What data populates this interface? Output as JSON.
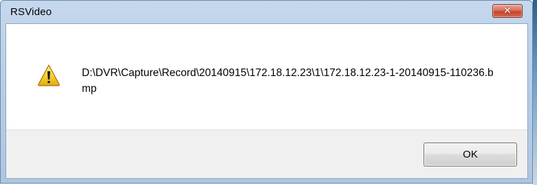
{
  "window": {
    "title": "RSVideo",
    "close_label": "✕"
  },
  "dialog": {
    "icon": "warning-icon",
    "message": "D:\\DVR\\Capture\\Record\\20140915\\172.18.12.23\\1\\172.18.12.23-1-20140915-110236.bmp"
  },
  "buttons": {
    "ok_label": "OK"
  },
  "colors": {
    "title_bar": "#b7cde6",
    "close_button": "#c5432b",
    "warning_yellow": "#f7d23b",
    "button_face": "#e5e5e5"
  }
}
